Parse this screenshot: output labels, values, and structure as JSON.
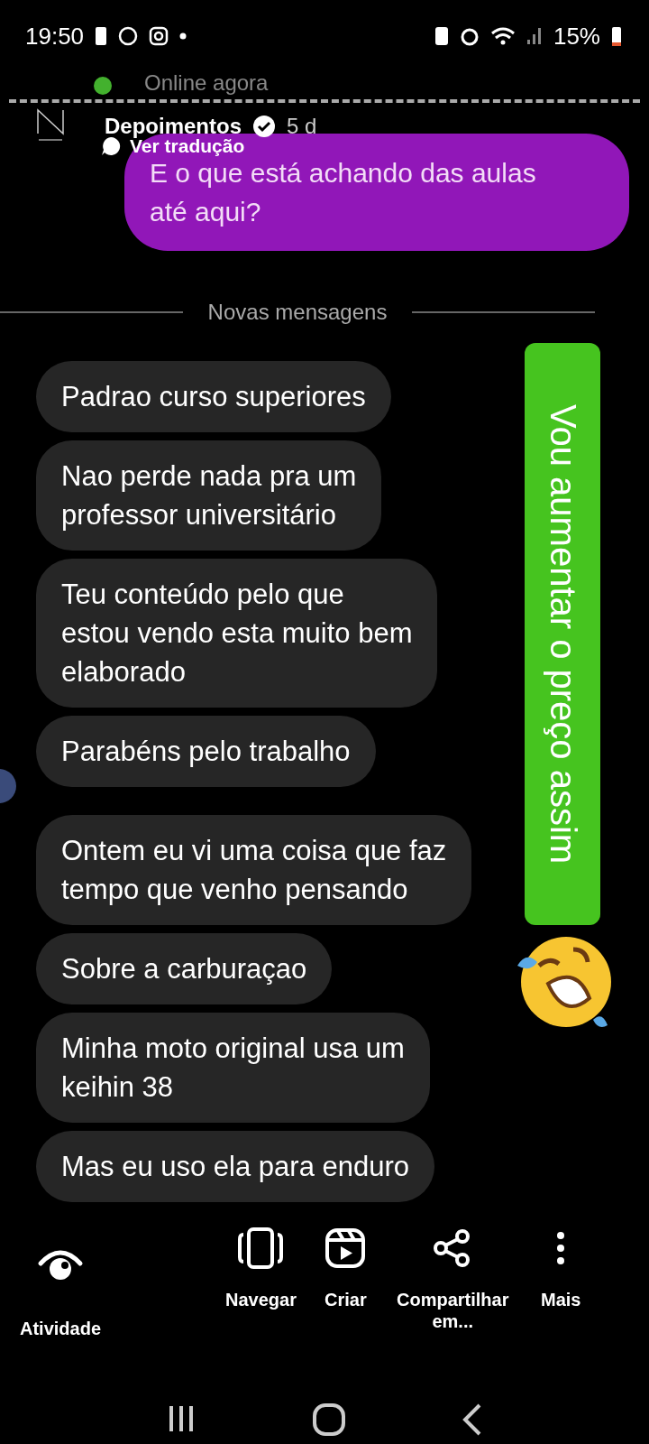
{
  "status_bar": {
    "time": "19:50",
    "battery": "15%"
  },
  "header": {
    "status": "Online agora",
    "account": "Depoimentos",
    "verified": true,
    "age": "5 d",
    "translate": "Ver tradução"
  },
  "reply_bubble": {
    "lines": [
      "E o que está achando das aulas",
      "até aqui?"
    ]
  },
  "divider": "Novas mensagens",
  "messages": [
    {
      "lines": [
        "Padrao curso superiores"
      ]
    },
    {
      "lines": [
        "Nao perde nada pra um",
        "professor universitário"
      ]
    },
    {
      "lines": [
        "Teu conteúdo pelo que",
        "estou vendo esta muito bem",
        "elaborado"
      ]
    },
    {
      "lines": [
        "Parabéns pelo trabalho"
      ]
    },
    {
      "lines": [
        "Ontem eu vi uma coisa que faz",
        "tempo que venho pensando"
      ]
    },
    {
      "lines": [
        "Sobre a carburaçao"
      ]
    },
    {
      "lines": [
        "Minha moto original usa um",
        "keihin 38"
      ]
    },
    {
      "lines": [
        "Mas eu uso ela para enduro"
      ]
    }
  ],
  "sticker_text": "Vou aumentar o preço assim",
  "actions": [
    {
      "kind": "activity",
      "label": "Atividade"
    },
    {
      "kind": "browse",
      "label": "Navegar"
    },
    {
      "kind": "create",
      "label": "Criar"
    },
    {
      "kind": "share",
      "label": "Compartilhar em..."
    },
    {
      "kind": "more",
      "label": "Mais"
    }
  ]
}
